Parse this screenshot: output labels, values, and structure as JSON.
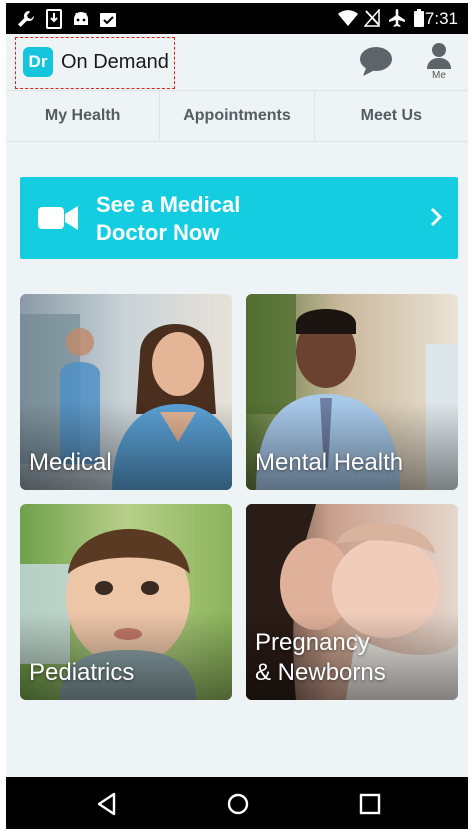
{
  "status_bar": {
    "time": "7:31",
    "left_icons": [
      "wrench-icon",
      "download-icon",
      "android-icon",
      "clipboard-check-icon"
    ],
    "right_icons": [
      "wifi-icon",
      "no-signal-icon",
      "airplane-icon",
      "battery-icon"
    ]
  },
  "app_bar": {
    "logo_badge": "Dr",
    "logo_text": "On Demand",
    "chat_icon": "chat-bubble-icon",
    "me_label": "Me"
  },
  "tabs": [
    {
      "label": "My Health"
    },
    {
      "label": "Appointments"
    },
    {
      "label": "Meet Us"
    }
  ],
  "cta": {
    "line1": "See a Medical",
    "line2": "Doctor Now",
    "icon": "video-camera-icon",
    "chevron": "chevron-right-icon"
  },
  "cards": [
    {
      "line1": "Medical",
      "line2": ""
    },
    {
      "line1": "Mental Health",
      "line2": ""
    },
    {
      "line1": "Pediatrics",
      "line2": ""
    },
    {
      "line1": "Pregnancy",
      "line2": "& Newborns"
    }
  ],
  "nav_bar": {
    "icons": [
      "back-icon",
      "home-icon",
      "recents-icon"
    ]
  },
  "colors": {
    "accent": "#14cde0",
    "background": "#eef4f5",
    "tab_text": "#555d63"
  }
}
